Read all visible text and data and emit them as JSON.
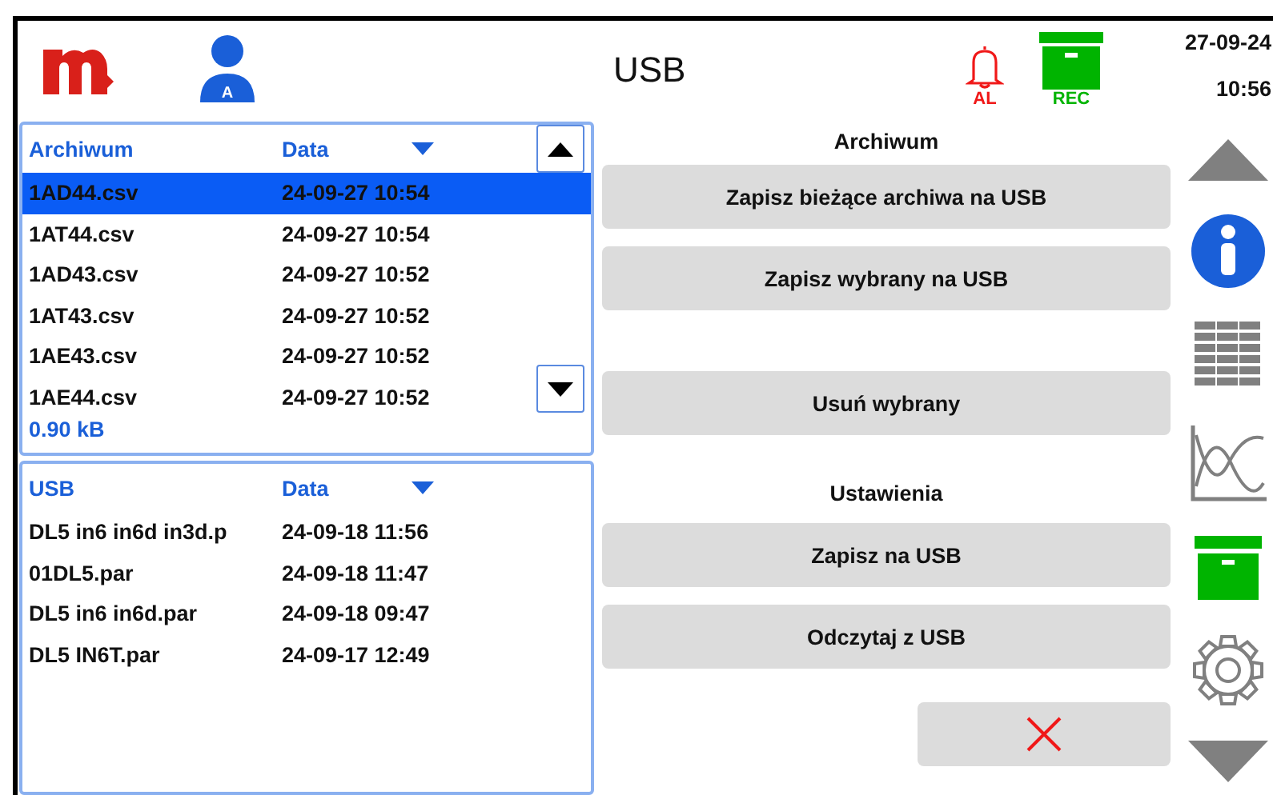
{
  "header": {
    "user_badge": "A",
    "title": "USB",
    "alarm_label": "AL",
    "rec_label": "REC",
    "date": "27-09-24",
    "time": "10:56"
  },
  "archive_list": {
    "columns": [
      "Archiwum",
      "Data"
    ],
    "rows": [
      {
        "name": "1AD44.csv",
        "date": "24-09-27 10:54",
        "selected": true
      },
      {
        "name": "1AT44.csv",
        "date": "24-09-27 10:54",
        "selected": false
      },
      {
        "name": "1AD43.csv",
        "date": "24-09-27 10:52",
        "selected": false
      },
      {
        "name": "1AT43.csv",
        "date": "24-09-27 10:52",
        "selected": false
      },
      {
        "name": "1AE43.csv",
        "date": "24-09-27 10:52",
        "selected": false
      },
      {
        "name": "1AE44.csv",
        "date": "24-09-27 10:52",
        "selected": false
      }
    ],
    "size": "0.90 kB"
  },
  "usb_list": {
    "columns": [
      "USB",
      "Data"
    ],
    "rows": [
      {
        "name": "DL5 in6 in6d in3d.p",
        "date": "24-09-18 11:56",
        "selected": false
      },
      {
        "name": "01DL5.par",
        "date": "24-09-18 11:47",
        "selected": false
      },
      {
        "name": "DL5 in6 in6d.par",
        "date": "24-09-18 09:47",
        "selected": false
      },
      {
        "name": "DL5 IN6T.par",
        "date": "24-09-17 12:49",
        "selected": false
      }
    ]
  },
  "actions": {
    "archive_heading": "Archiwum",
    "archive_buttons": [
      "Zapisz bieżące archiwa na USB",
      "Zapisz wybrany na USB"
    ],
    "delete_button": "Usuń wybrany",
    "settings_heading": "Ustawienia",
    "settings_buttons": [
      "Zapisz na USB",
      "Odczytaj z USB"
    ]
  }
}
